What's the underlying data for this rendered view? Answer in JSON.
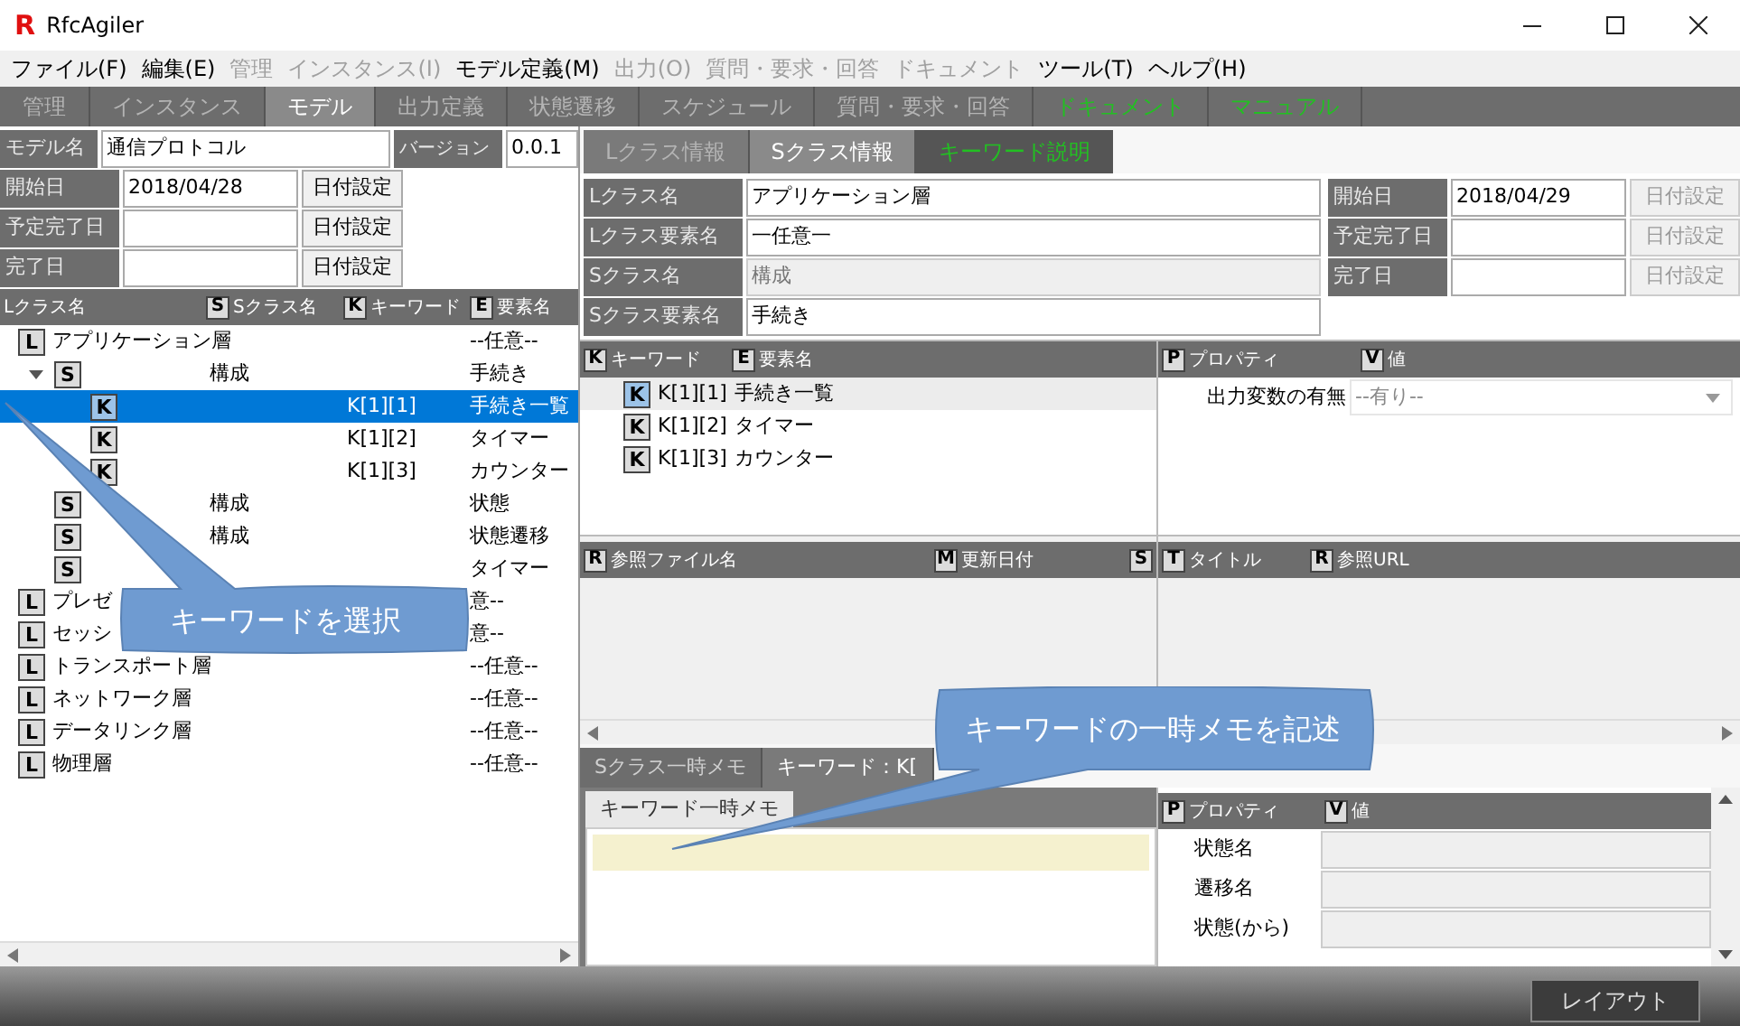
{
  "window": {
    "title": "RfcAgiler",
    "logo": "R"
  },
  "menu": [
    {
      "label": "ファイル(F)",
      "disabled": false
    },
    {
      "label": "編集(E)",
      "disabled": false
    },
    {
      "label": "管理",
      "disabled": true
    },
    {
      "label": "インスタンス(I)",
      "disabled": true
    },
    {
      "label": "モデル定義(M)",
      "disabled": false
    },
    {
      "label": "出力(O)",
      "disabled": true
    },
    {
      "label": "質問・要求・回答",
      "disabled": true
    },
    {
      "label": "ドキュメント",
      "disabled": true
    },
    {
      "label": "ツール(T)",
      "disabled": false
    },
    {
      "label": "ヘルプ(H)",
      "disabled": false
    }
  ],
  "tabs": [
    {
      "label": "管理",
      "selected": false,
      "kind": "page"
    },
    {
      "label": "インスタンス",
      "selected": false,
      "kind": "page"
    },
    {
      "label": "モデル",
      "selected": true,
      "kind": "page"
    },
    {
      "label": "出力定義",
      "selected": false,
      "kind": "page"
    },
    {
      "label": "状態遷移",
      "selected": false,
      "kind": "page"
    },
    {
      "label": "スケジュール",
      "selected": false,
      "kind": "page"
    },
    {
      "label": "質問・要求・回答",
      "selected": false,
      "kind": "page"
    },
    {
      "label": "ドキュメント",
      "selected": false,
      "kind": "link"
    },
    {
      "label": "マニュアル",
      "selected": false,
      "kind": "link"
    }
  ],
  "model": {
    "name_label": "モデル名",
    "name": "通信プロトコル",
    "version_label": "バージョン",
    "version": "0.0.1"
  },
  "dates": [
    {
      "label": "開始日",
      "value": "2018/04/28",
      "button": "日付設定",
      "disabled": false
    },
    {
      "label": "予定完了日",
      "button": "日付設定",
      "disabled": false
    },
    {
      "label": "完了日",
      "button": "日付設定",
      "disabled": false
    }
  ],
  "tree": {
    "columns": [
      {
        "label": "Lクラス名"
      },
      {
        "badge": "S",
        "label": "Sクラス名"
      },
      {
        "badge": "K",
        "label": "キーワード"
      },
      {
        "badge": "E",
        "label": "要素名"
      }
    ],
    "items": [
      {
        "badge": "L",
        "name": "アプリケーション層",
        "element": "--任意--",
        "selected": false,
        "children": [
          {
            "badge": "S",
            "sclass": "構成",
            "element": "手続き",
            "expanded": true,
            "selected": false,
            "children": [
              {
                "badge": "K",
                "keyword": "K[1][1]",
                "element": "手続き一覧",
                "selected": true
              },
              {
                "badge": "K",
                "keyword": "K[1][2]",
                "element": "タイマー",
                "selected": false
              },
              {
                "badge": "K",
                "keyword": "K[1][3]",
                "element": "カウンター",
                "selected": false
              }
            ]
          },
          {
            "badge": "S",
            "sclass": "構成",
            "element": "状態",
            "expanded": false,
            "selected": false
          },
          {
            "badge": "S",
            "sclass": "構成",
            "element": "状態遷移",
            "expanded": false,
            "selected": false
          },
          {
            "badge": "S",
            "element": "タイマー",
            "expanded": false,
            "selected": false
          }
        ]
      },
      {
        "badge": "L",
        "name": "プレゼ",
        "element": "意--",
        "selected": false
      },
      {
        "badge": "L",
        "name": "セッシ",
        "element": "意--",
        "selected": false
      },
      {
        "badge": "L",
        "name": "トランスポート層",
        "element": "--任意--",
        "selected": false
      },
      {
        "badge": "L",
        "name": "ネットワーク層",
        "element": "--任意--",
        "selected": false
      },
      {
        "badge": "L",
        "name": "データリンク層",
        "element": "--任意--",
        "selected": false
      },
      {
        "badge": "L",
        "name": "物理層",
        "element": "--任意--",
        "selected": false
      }
    ]
  },
  "subtabs": [
    {
      "label": "Lクラス情報",
      "selected": false,
      "kind": "page"
    },
    {
      "label": "Sクラス情報",
      "selected": true,
      "kind": "page"
    },
    {
      "label": "キーワード説明",
      "selected": false,
      "kind": "link"
    }
  ],
  "class_info": [
    {
      "label": "Lクラス名",
      "value": "アプリケーション層",
      "disabled": false
    },
    {
      "label": "Lクラス要素名",
      "value": "一任意一",
      "disabled": false
    },
    {
      "label": "Sクラス名",
      "value": "構成",
      "disabled": true
    },
    {
      "label": "Sクラス要素名",
      "value": "手続き",
      "disabled": false
    }
  ],
  "class_dates": [
    {
      "label": "開始日",
      "value": "2018/04/29",
      "button": "日付設定",
      "disabled": true
    },
    {
      "label": "予定完了日",
      "button": "日付設定",
      "disabled": true
    },
    {
      "label": "完了日",
      "button": "日付設定",
      "disabled": true
    }
  ],
  "keywords": {
    "columns": [
      {
        "badge": "K",
        "label": "キーワード"
      },
      {
        "badge": "E",
        "label": "要素名"
      }
    ],
    "rows": [
      {
        "badge": "K",
        "keyword": "K[1][1]",
        "element": "手続き一覧",
        "selected": true
      },
      {
        "badge": "K",
        "keyword": "K[1][2]",
        "element": "タイマー",
        "selected": false
      },
      {
        "badge": "K",
        "keyword": "K[1][3]",
        "element": "カウンター",
        "selected": false
      }
    ]
  },
  "properties": {
    "columns": [
      {
        "badge": "P",
        "label": "プロパティ"
      },
      {
        "badge": "V",
        "label": "値"
      }
    ],
    "rows": [
      {
        "name": "出力変数の有無",
        "value": "--有り--",
        "disabled": true
      }
    ]
  },
  "references": {
    "columns": [
      {
        "badge": "R",
        "label": "参照ファイル名"
      },
      {
        "badge": "M",
        "label": "更新日付"
      },
      {
        "badge": "S"
      }
    ]
  },
  "links": {
    "columns": [
      {
        "badge": "T",
        "label": "タイトル"
      },
      {
        "badge": "R",
        "label": "参照URL"
      }
    ]
  },
  "memo_tabs": [
    {
      "label": "Sクラス一時メモ",
      "selected": false
    },
    {
      "label": "キーワード：K[",
      "selected": true
    }
  ],
  "memo": {
    "tab": "キーワード一時メモ"
  },
  "state_properties": {
    "columns": [
      {
        "badge": "P",
        "label": "プロパティ"
      },
      {
        "badge": "V",
        "label": "値"
      }
    ],
    "rows": [
      {
        "name": "状態名"
      },
      {
        "name": "遷移名"
      },
      {
        "name": "状態(から)"
      }
    ]
  },
  "status_bar": {
    "button": "レイアウト"
  },
  "callouts": [
    {
      "text": "キーワードを選択"
    },
    {
      "text": "キーワードの一時メモを記述"
    }
  ]
}
